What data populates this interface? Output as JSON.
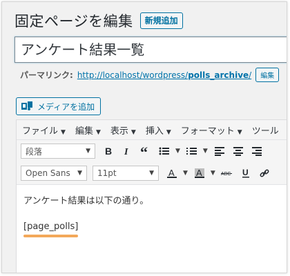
{
  "header": {
    "title": "固定ページを編集",
    "new_button": "新規追加"
  },
  "title_field": {
    "value": "アンケート結果一覧"
  },
  "permalink": {
    "label": "パーマリンク:",
    "url_prefix": "http://localhost/wordpress/",
    "url_slug": "polls_archive",
    "url_suffix": "/",
    "edit_button": "編集"
  },
  "media_button": {
    "label": "メディアを追加",
    "icon": "add-media-icon"
  },
  "menubar": {
    "items": [
      {
        "label": "ファイル"
      },
      {
        "label": "編集"
      },
      {
        "label": "表示"
      },
      {
        "label": "挿入"
      },
      {
        "label": "フォーマット"
      },
      {
        "label": "ツール"
      }
    ]
  },
  "toolbar": {
    "format_select": "段落",
    "font_select": "Open Sans",
    "size_select": "11pt"
  },
  "content": {
    "paragraph": "アンケート結果は以下の通り。",
    "shortcode": "[page_polls]",
    "highlight_color": "#f3a85a"
  }
}
